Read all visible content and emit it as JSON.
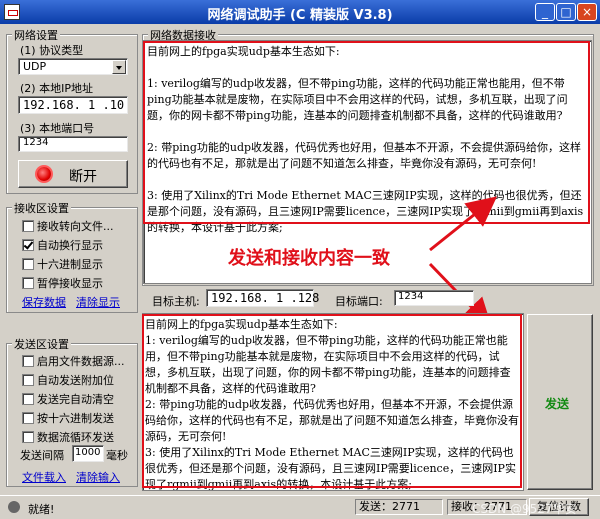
{
  "window": {
    "title": "网络调试助手 (C 精装版 V3.8)",
    "minimize": "_",
    "maximize": "□",
    "close": "×"
  },
  "net": {
    "group_title": "网络设置",
    "protocol_label": "(1) 协议类型",
    "protocol_value": "UDP",
    "ip_label": "(2) 本地IP地址",
    "ip_value": "192.168. 1 .10",
    "port_label": "(3) 本地端口号",
    "port_value": "1234",
    "disconnect_label": "断开"
  },
  "recv_settings": {
    "group_title": "接收区设置",
    "options": [
      {
        "label": "接收转向文件...",
        "checked": false
      },
      {
        "label": "自动换行显示",
        "checked": true
      },
      {
        "label": "十六进制显示",
        "checked": false
      },
      {
        "label": "暂停接收显示",
        "checked": false
      }
    ],
    "save_data": "保存数据",
    "clear_display": "清除显示"
  },
  "send_settings": {
    "group_title": "发送区设置",
    "options": [
      {
        "label": "启用文件数据源...",
        "checked": false
      },
      {
        "label": "自动发送附加位",
        "checked": false
      },
      {
        "label": "发送完自动清空",
        "checked": false
      },
      {
        "label": "按十六进制发送",
        "checked": false
      },
      {
        "label": "数据流循环发送",
        "checked": false
      }
    ],
    "interval_label": "发送间隔",
    "interval_value": "1000",
    "interval_unit": "毫秒",
    "file_load": "文件载入",
    "clear_input": "清除输入"
  },
  "recv_area": {
    "title": "网络数据接收",
    "text": "目前网上的fpga实现udp基本生态如下:\n\n1: verilog编写的udp收发器，但不带ping功能，这样的代码功能正常也能用，但不带ping功能基本就是废物，在实际项目中不会用这样的代码，试想，多机互联，出现了问题，你的网卡都不带ping功能，连基本的问题排查机制都不具备，这样的代码谁敢用?\n\n2: 带ping功能的udp收发器，代码优秀也好用，但基本不开源，不会提供源码给你，这样的代码也有不足，那就是出了问题不知道怎么排查，毕竟你没有源码，无可奈何!\n\n3: 使用了Xilinx的Tri Mode Ethernet MAC三速网IP实现，这样的代码也很优秀，但还是那个问题，没有源码，且三速网IP需要licence，三速网IP实现了rgmii到gmii再到axis的转换，本设计基于此方案;"
  },
  "annotation": "发送和接收内容一致",
  "target": {
    "host_label": "目标主机:",
    "host_value": "192.168. 1 .128",
    "port_label": "目标端口:",
    "port_value": "1234"
  },
  "send_area": {
    "text": "目前网上的fpga实现udp基本生态如下:\n1: verilog编写的udp收发器，但不带ping功能，这样的代码功能正常也能用，但不带ping功能基本就是废物，在实际项目中不会用这样的代码，试想，多机互联，出现了问题，你的网卡都不带ping功能，连基本的问题排查机制都不具备，这样的代码谁敢用?\n2: 带ping功能的udp收发器，代码优秀也好用，但基本不开源，不会提供源码给你，这样的代码也有不足，那就是出了问题不知道怎么排查，毕竟你没有源码，无可奈何!\n3: 使用了Xilinx的Tri Mode Ethernet MAC三速网IP实现，这样的代码也很优秀，但还是那个问题，没有源码，且三速网IP需要licence，三速网IP实现了rgmii到gmii再到axis的转换，本设计基于此方案;",
    "send_button": "发送"
  },
  "status": {
    "ready": "就绪!",
    "send_label": "发送：",
    "send_count": "2771",
    "recv_label": "接收：",
    "recv_count": "2771",
    "reset": "复位计数"
  },
  "watermark": "CSDN @9527华安",
  "colors": {
    "annotation": "#e0101a",
    "title_bar": "#0a3ca8",
    "send_button_text": "#138a13"
  }
}
